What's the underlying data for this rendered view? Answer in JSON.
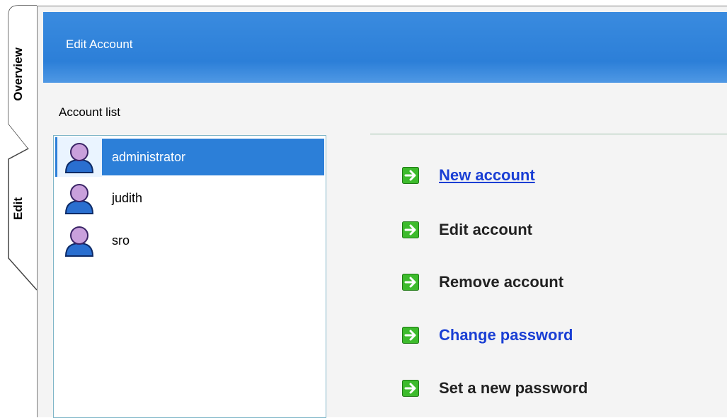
{
  "side_tabs": [
    {
      "label": "Overview"
    },
    {
      "label": "Edit"
    }
  ],
  "header": {
    "title": "Edit Account"
  },
  "account_list": {
    "label": "Account list",
    "items": [
      {
        "name": "administrator",
        "selected": true
      },
      {
        "name": "judith",
        "selected": false
      },
      {
        "name": "sro",
        "selected": false
      }
    ]
  },
  "actions": [
    {
      "label": "New account",
      "style": "link-underline"
    },
    {
      "label": "Edit account",
      "style": "plain"
    },
    {
      "label": "Remove account",
      "style": "plain"
    },
    {
      "label": "Change password",
      "style": "link"
    },
    {
      "label": "Set a new password",
      "style": "plain"
    }
  ],
  "colors": {
    "header_blue": "#2c7fd8",
    "link_blue": "#1a3fd4",
    "arrow_green": "#3dbb2c",
    "avatar_head": "#c9a0dc",
    "avatar_body": "#2a6fd0"
  }
}
